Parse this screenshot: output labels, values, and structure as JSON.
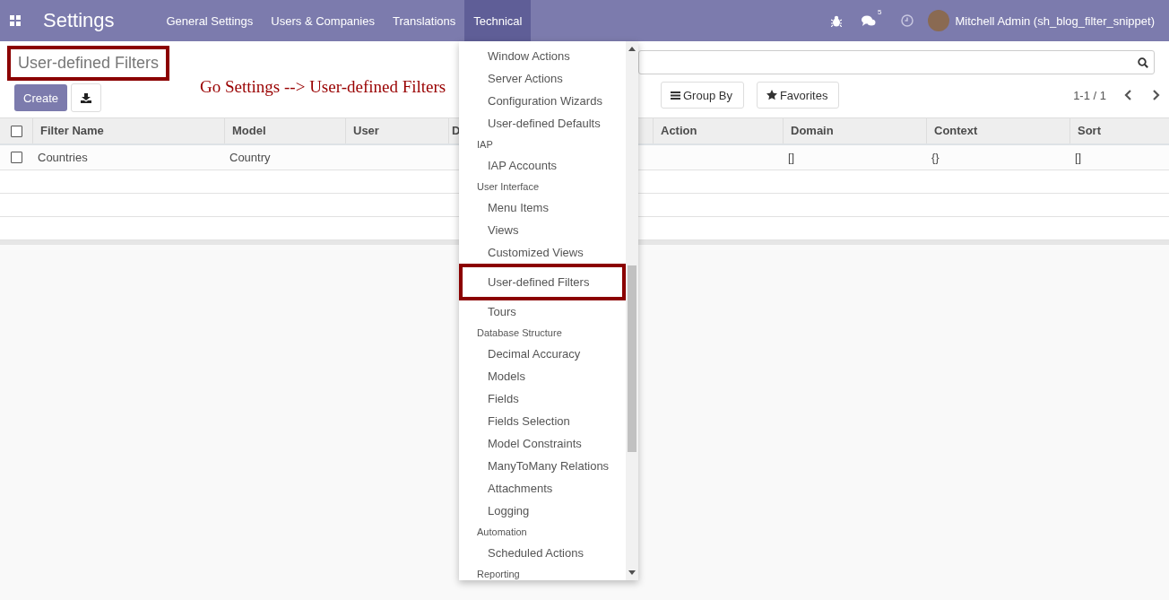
{
  "navbar": {
    "app_title": "Settings",
    "menus": [
      {
        "label": "General Settings",
        "selected": false
      },
      {
        "label": "Users & Companies",
        "selected": false
      },
      {
        "label": "Translations",
        "selected": false
      },
      {
        "label": "Technical",
        "selected": true
      }
    ],
    "messages_badge": "5",
    "user_name": "Mitchell Admin (sh_blog_filter_snippet)"
  },
  "breadcrumb": {
    "title": "User-defined Filters",
    "highlighted": true
  },
  "annotation": "Go Settings --> User-defined Filters",
  "create_button": "Create",
  "filter_buttons": [
    {
      "kind": "group",
      "label": "Group By"
    },
    {
      "kind": "favorites",
      "label": "Favorites"
    }
  ],
  "pager": "1-1 / 1",
  "table": {
    "columns": [
      "Filter Name",
      "Model",
      "User",
      "D",
      "Action",
      "Domain",
      "Context",
      "Sort"
    ],
    "header_checked": false,
    "rows": [
      {
        "checked": false,
        "cells": [
          "Countries",
          "Country",
          null,
          null,
          null,
          "[]",
          "{}",
          "[]"
        ]
      }
    ]
  },
  "dropdown": {
    "sections": [
      {
        "items": [
          {
            "label": "Window Actions",
            "highlighted": false
          },
          {
            "label": "Server Actions",
            "highlighted": false
          },
          {
            "label": "Configuration Wizards",
            "highlighted": false
          },
          {
            "label": "User-defined Defaults",
            "highlighted": false
          }
        ]
      },
      {
        "title": "IAP",
        "items": [
          {
            "label": "IAP Accounts",
            "highlighted": false
          }
        ]
      },
      {
        "title": "User Interface",
        "items": [
          {
            "label": "Menu Items",
            "highlighted": false
          },
          {
            "label": "Views",
            "highlighted": false
          },
          {
            "label": "Customized Views",
            "highlighted": false
          },
          {
            "label": "User-defined Filters",
            "highlighted": true
          },
          {
            "label": "Tours",
            "highlighted": false
          }
        ]
      },
      {
        "title": "Database Structure",
        "items": [
          {
            "label": "Decimal Accuracy",
            "highlighted": false
          },
          {
            "label": "Models",
            "highlighted": false
          },
          {
            "label": "Fields",
            "highlighted": false
          },
          {
            "label": "Fields Selection",
            "highlighted": false
          },
          {
            "label": "Model Constraints",
            "highlighted": false
          },
          {
            "label": "ManyToMany Relations",
            "highlighted": false
          },
          {
            "label": "Attachments",
            "highlighted": false
          },
          {
            "label": "Logging",
            "highlighted": false
          }
        ]
      },
      {
        "title": "Automation",
        "items": [
          {
            "label": "Scheduled Actions",
            "highlighted": false
          }
        ]
      },
      {
        "title": "Reporting"
      }
    ]
  }
}
